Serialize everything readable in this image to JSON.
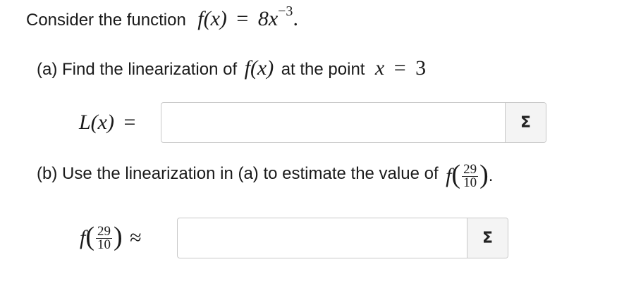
{
  "problem": {
    "intro_text": "Consider the function",
    "function_lhs": "f(x)",
    "equals": "=",
    "function_coef": "8x",
    "function_exp": "−3",
    "period": "."
  },
  "part_a": {
    "prompt_text": "(a) Find the linearization of",
    "fx": "f(x)",
    "at_text": "at the point",
    "point_var": "x",
    "point_equals": "=",
    "point_value": "3",
    "answer_label": "L(x)",
    "answer_equals": "=",
    "answer_value": "",
    "sigma_label": "Σ"
  },
  "part_b": {
    "prompt_text": "(b) Use the linearization in (a) to estimate the value of",
    "f": "f",
    "frac_num": "29",
    "frac_den": "10",
    "period": ".",
    "approx": "≈",
    "answer_value": "",
    "sigma_label": "Σ"
  }
}
